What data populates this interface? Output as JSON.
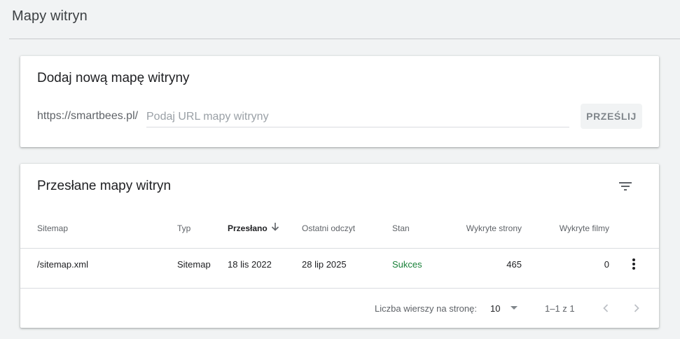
{
  "page": {
    "title": "Mapy witryn"
  },
  "add_card": {
    "title": "Dodaj nową mapę witryny",
    "url_prefix": "https://smartbees.pl/",
    "input_placeholder": "Podaj URL mapy witryny",
    "input_value": "",
    "submit_label": "PRZEŚLIJ"
  },
  "list_card": {
    "title": "Przesłane mapy witryn",
    "columns": {
      "sitemap": "Sitemap",
      "type": "Typ",
      "submitted": "Przesłano",
      "last_read": "Ostatni odczyt",
      "status": "Stan",
      "pages": "Wykryte strony",
      "videos": "Wykryte filmy"
    },
    "rows": [
      {
        "sitemap": "/sitemap.xml",
        "type": "Sitemap",
        "submitted": "18 lis 2022",
        "last_read": "28 lip 2025",
        "status": "Sukces",
        "pages": "465",
        "videos": "0"
      }
    ],
    "footer": {
      "rows_per_page_label": "Liczba wierszy na stronę:",
      "rows_per_page_value": "10",
      "range": "1–1 z 1"
    }
  },
  "icons": {
    "filter": "filter-icon",
    "sort": "arrow-down-icon",
    "more": "more-vert-icon",
    "prev": "chevron-left-icon",
    "next": "chevron-right-icon"
  },
  "colors": {
    "success": "#188038",
    "background": "#f1f3f4"
  }
}
